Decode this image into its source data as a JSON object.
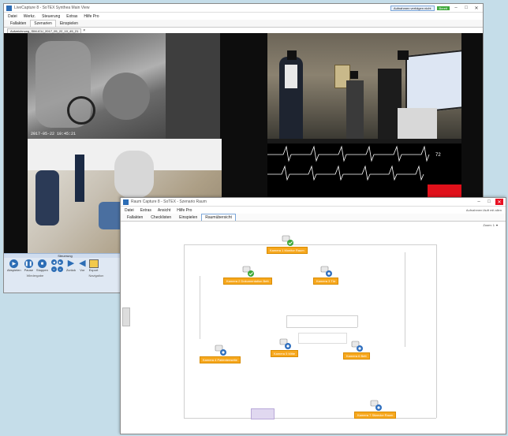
{
  "back_window": {
    "title": "LiveCapture 8 - SoTEX Synthea Main View",
    "menu": [
      "Datei",
      "Werkz.",
      "Steuerung",
      "Extras",
      "Hilfe Pro"
    ],
    "tabs": [
      "Fallakten",
      "Szenarien",
      "Einspielen"
    ],
    "active_tab": 1,
    "file_tab": "Aufzeichnung_SIM-ICU_2017_05_22_10_45_21",
    "top_btn_label": "Aufnahmen verfolgen nicht",
    "status_label": "Bereit",
    "cam1_timestamp": "2017-05-22 10:45:21",
    "monitor_value": "72",
    "control_group_title": "Steuerung",
    "controls": [
      "Abspielen",
      "Pause",
      "Stoppen",
      "Zurück",
      "Vor",
      "Einzelbild",
      "Vollbild",
      "Export"
    ],
    "group_labels": [
      "Wiedergabe",
      "Navigation"
    ]
  },
  "front_window": {
    "title": "Raum Capture 8 - SoTEX - Szenario Raum",
    "menu": [
      "Datei",
      "Extras",
      "Ansicht",
      "Hilfe Pro"
    ],
    "tabs": [
      "Fallakten",
      "Checklisten",
      "Einspielen",
      "Raumübersicht"
    ],
    "active_tab": 3,
    "right_text": "Aufnahmen läuft mit allen",
    "zoom_label": "Zoom: 1",
    "markers": [
      {
        "label": "Kamera 1 Monitor Raum",
        "status": "ok"
      },
      {
        "label": "Kamera 2 Dokumentation Bett",
        "status": "ok"
      },
      {
        "label": "Kamera 3 Tür",
        "status": "info"
      },
      {
        "label": "Kamera 4 Patientenseite",
        "status": "info"
      },
      {
        "label": "Kamera 5 Mitte",
        "status": "info"
      },
      {
        "label": "Kamera 6 Bett",
        "status": "info"
      },
      {
        "label": "Kamera 7 Sitzecke Raum",
        "status": "info"
      }
    ]
  },
  "colors": {
    "background": "#c5dde9",
    "marker_orange": "#f7a81e",
    "status_ok": "#3ea83a",
    "status_info": "#2f6fbf",
    "window_active": "#2c6db5",
    "alarm_red": "#e0101a"
  }
}
